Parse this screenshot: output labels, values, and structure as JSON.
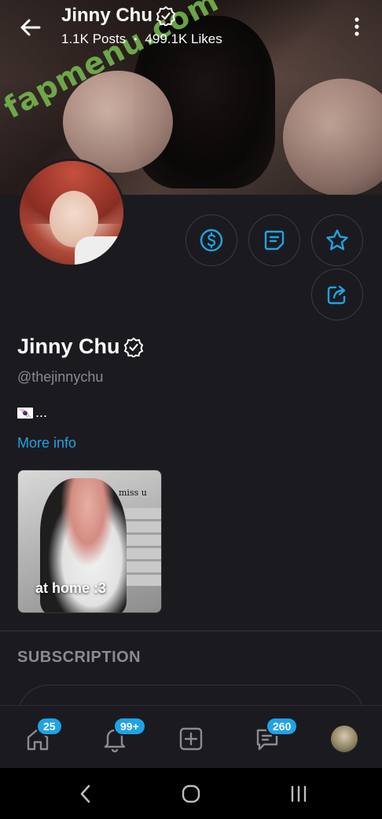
{
  "header": {
    "name": "Jinny Chu",
    "posts": "1.1K Posts",
    "likes": "499.1K Likes",
    "separator": "•"
  },
  "watermark": "fapmenu.com",
  "profile": {
    "name": "Jinny Chu",
    "handle": "@thejinnychu",
    "bio_suffix": "...",
    "more_info": "More info"
  },
  "story": {
    "caption": "at home :3",
    "overlay_text": "miss u"
  },
  "subscription": {
    "heading": "SUBSCRIPTION"
  },
  "bottom_nav": {
    "home_badge": "25",
    "notifications_badge": "99+",
    "messages_badge": "260"
  },
  "colors": {
    "accent": "#1fa3e5",
    "background": "#1b1b1f",
    "muted": "#8a8a90"
  },
  "icons": {
    "back": "arrow-left-icon",
    "more": "more-vertical-icon",
    "verified": "verified-badge-icon",
    "tip": "dollar-circle-icon",
    "notes": "note-icon",
    "favorite": "star-icon",
    "share": "share-icon"
  }
}
